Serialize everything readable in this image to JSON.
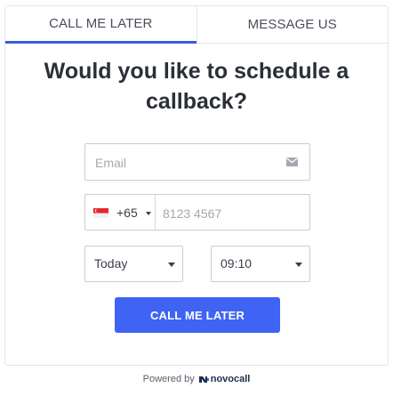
{
  "tabs": [
    {
      "label": "CALL ME LATER",
      "active": true
    },
    {
      "label": "MESSAGE US",
      "active": false
    }
  ],
  "title": "Would you like to schedule a callback?",
  "email": {
    "placeholder": "Email",
    "value": "",
    "icon": "envelope-icon"
  },
  "phone": {
    "country_flag": "singapore-flag-icon",
    "dial_code": "+65",
    "placeholder": "8123 4567",
    "value": ""
  },
  "day_select": {
    "value": "Today"
  },
  "time_select": {
    "value": "09:10"
  },
  "submit": {
    "label": "CALL ME LATER"
  },
  "footer": {
    "powered_by": "Powered by",
    "brand": "novocall"
  },
  "colors": {
    "accent": "#3f63f2",
    "tab_underline": "#3a5bd9",
    "flag_red": "#e0282e",
    "brand_text": "#1c2e4a",
    "brand_icon": "#3f63f2"
  }
}
